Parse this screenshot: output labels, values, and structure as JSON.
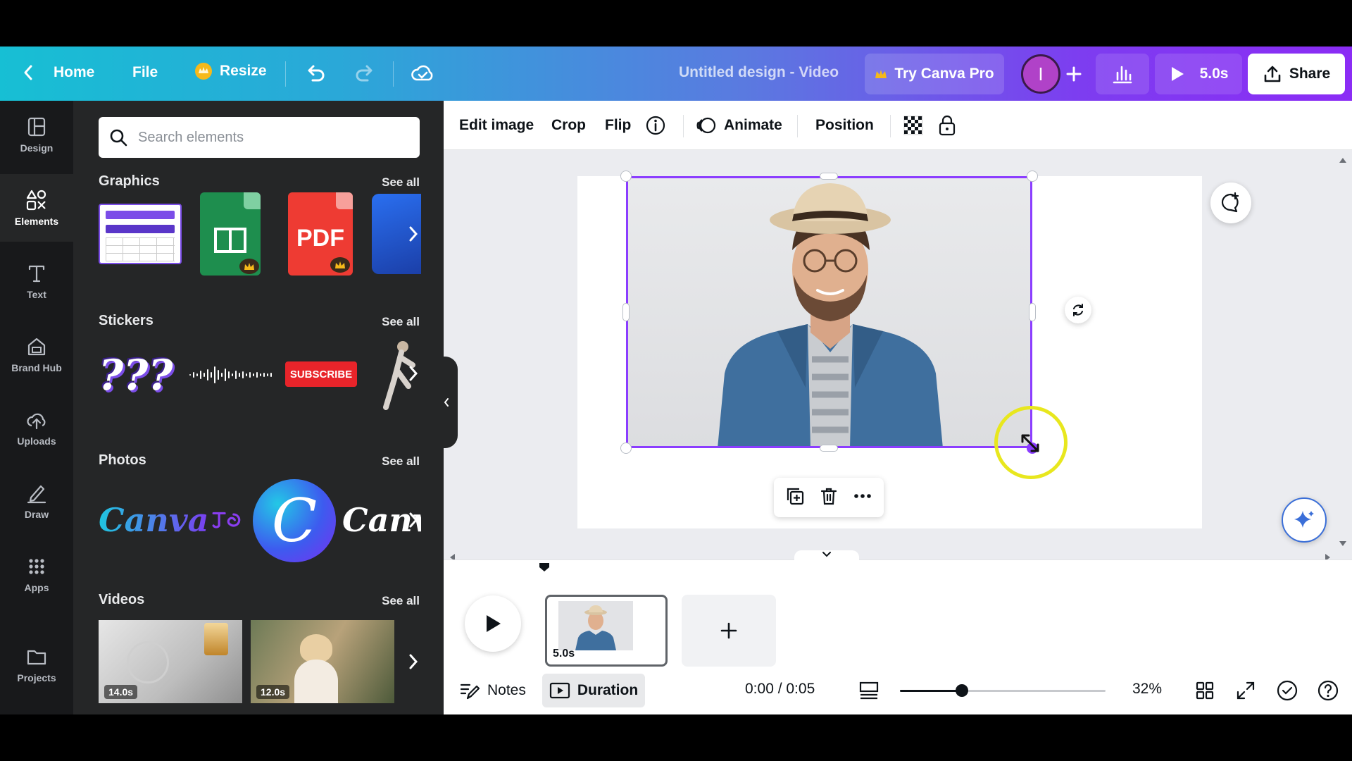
{
  "topbar": {
    "home_label": "Home",
    "file_label": "File",
    "resize_label": "Resize",
    "design_title": "Untitled design - Video",
    "try_pro_label": "Try Canva Pro",
    "avatar_initial": "I",
    "play_duration": "5.0s",
    "share_label": "Share"
  },
  "rail": {
    "items": [
      {
        "label": "Design",
        "icon": "design-icon"
      },
      {
        "label": "Elements",
        "icon": "elements-icon",
        "active": true
      },
      {
        "label": "Text",
        "icon": "text-icon"
      },
      {
        "label": "Brand Hub",
        "icon": "brand-hub-icon"
      },
      {
        "label": "Uploads",
        "icon": "uploads-icon"
      },
      {
        "label": "Draw",
        "icon": "draw-icon"
      },
      {
        "label": "Apps",
        "icon": "apps-icon"
      },
      {
        "label": "Projects",
        "icon": "projects-icon"
      }
    ]
  },
  "panel": {
    "search_placeholder": "Search elements",
    "see_all": "See all",
    "sections": {
      "graphics": "Graphics",
      "stickers": "Stickers",
      "photos": "Photos",
      "videos": "Videos"
    },
    "pdf_label": "PDF",
    "subscribe_label": "SUBSCRIBE",
    "sticker_text": "???",
    "photo_text_1": "Canva",
    "photo_text_2": "Canv",
    "photo_c": "C",
    "video_durations": [
      "14.0s",
      "12.0s"
    ]
  },
  "toolbar": {
    "edit_image": "Edit image",
    "crop": "Crop",
    "flip": "Flip",
    "animate": "Animate",
    "position": "Position"
  },
  "timeline": {
    "page_duration": "5.0s",
    "time_readout": "0:00 / 0:05",
    "notes_label": "Notes",
    "duration_label": "Duration",
    "zoom_level": "32%",
    "zoom_fraction": 0.3
  },
  "colors": {
    "accent": "#8b3dff",
    "topbar_start": "#17bfd4",
    "topbar_end": "#8b2cf5",
    "panel_bg": "#252627",
    "rail_bg": "#18191b"
  }
}
